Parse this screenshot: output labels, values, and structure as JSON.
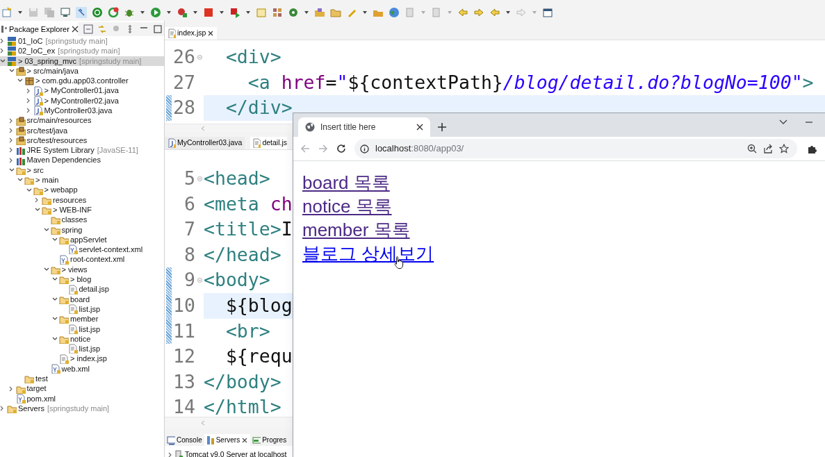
{
  "package_explorer": {
    "title": "Package Explorer",
    "items": [
      {
        "label": "01_IoC",
        "kind": "project",
        "decoration": "[springstudy main]",
        "expanded": false,
        "selected": false
      },
      {
        "label": "02_IoC_ex",
        "kind": "project",
        "decoration": "[springstudy main]",
        "expanded": false,
        "selected": false
      },
      {
        "label": "> 03_spring_mvc",
        "kind": "project",
        "decoration": "[springstudy main]",
        "expanded": true,
        "selected": true,
        "children": [
          {
            "label": "> src/main/java",
            "kind": "source-folder",
            "expanded": true,
            "selected": false,
            "children": [
              {
                "label": "> com.gdu.app03.controller",
                "kind": "package",
                "expanded": true,
                "selected": false,
                "children": [
                  {
                    "label": "> MyController01.java",
                    "kind": "java",
                    "expanded": false,
                    "selected": false
                  },
                  {
                    "label": "> MyController02.java",
                    "kind": "java",
                    "expanded": false,
                    "selected": false
                  },
                  {
                    "label": "MyController03.java",
                    "kind": "java",
                    "expanded": false,
                    "selected": false
                  }
                ]
              }
            ]
          },
          {
            "label": "src/main/resources",
            "kind": "source-folder",
            "expanded": false,
            "selected": false
          },
          {
            "label": "src/test/java",
            "kind": "source-folder",
            "expanded": false,
            "selected": false
          },
          {
            "label": "src/test/resources",
            "kind": "source-folder",
            "expanded": false,
            "selected": false
          },
          {
            "label": "JRE System Library",
            "kind": "library",
            "decoration": "[JavaSE-11]",
            "expanded": false,
            "selected": false
          },
          {
            "label": "Maven Dependencies",
            "kind": "library",
            "expanded": false,
            "selected": false
          },
          {
            "label": "> src",
            "kind": "folder",
            "expanded": true,
            "selected": false,
            "children": [
              {
                "label": "> main",
                "kind": "folder",
                "expanded": true,
                "selected": false,
                "children": [
                  {
                    "label": "> webapp",
                    "kind": "folder",
                    "expanded": true,
                    "selected": false,
                    "children": [
                      {
                        "label": "resources",
                        "kind": "folder",
                        "expanded": false,
                        "selected": false
                      },
                      {
                        "label": "> WEB-INF",
                        "kind": "folder",
                        "expanded": true,
                        "selected": false,
                        "children": [
                          {
                            "label": "classes",
                            "kind": "folder",
                            "selected": false
                          },
                          {
                            "label": "spring",
                            "kind": "folder",
                            "expanded": true,
                            "selected": false,
                            "children": [
                              {
                                "label": "appServlet",
                                "kind": "folder",
                                "expanded": true,
                                "selected": false,
                                "children": [
                                  {
                                    "label": "servlet-context.xml",
                                    "kind": "xml",
                                    "selected": false
                                  }
                                ]
                              },
                              {
                                "label": "root-context.xml",
                                "kind": "xml",
                                "selected": false
                              }
                            ]
                          },
                          {
                            "label": "> views",
                            "kind": "folder",
                            "expanded": true,
                            "selected": false,
                            "children": [
                              {
                                "label": "> blog",
                                "kind": "folder",
                                "expanded": true,
                                "selected": false,
                                "children": [
                                  {
                                    "label": "detail.jsp",
                                    "kind": "jsp",
                                    "selected": false
                                  }
                                ]
                              },
                              {
                                "label": "board",
                                "kind": "folder",
                                "expanded": true,
                                "selected": false,
                                "children": [
                                  {
                                    "label": "list.jsp",
                                    "kind": "jsp",
                                    "selected": false
                                  }
                                ]
                              },
                              {
                                "label": "member",
                                "kind": "folder",
                                "expanded": true,
                                "selected": false,
                                "children": [
                                  {
                                    "label": "list.jsp",
                                    "kind": "jsp",
                                    "selected": false
                                  }
                                ]
                              },
                              {
                                "label": "notice",
                                "kind": "folder",
                                "expanded": true,
                                "selected": false,
                                "children": [
                                  {
                                    "label": "list.jsp",
                                    "kind": "jsp",
                                    "selected": false
                                  }
                                ]
                              },
                              {
                                "label": "> index.jsp",
                                "kind": "jsp",
                                "selected": false
                              }
                            ]
                          },
                          {
                            "label": "web.xml",
                            "kind": "xml",
                            "selected": false
                          }
                        ]
                      }
                    ]
                  }
                ]
              },
              {
                "label": "test",
                "kind": "folder",
                "selected": false
              }
            ]
          },
          {
            "label": "target",
            "kind": "folder",
            "expanded": false,
            "selected": false
          },
          {
            "label": "pom.xml",
            "kind": "xml",
            "selected": false
          }
        ]
      },
      {
        "label": "Servers",
        "kind": "folder",
        "decoration": "[springstudy main]",
        "expanded": false,
        "selected": false
      }
    ]
  },
  "editors": [
    {
      "tabs": [
        {
          "label": "index.jsp",
          "kind": "jsp",
          "selected": true
        }
      ],
      "lines": [
        {
          "number": "26",
          "foldable": true,
          "changed": false,
          "current": false,
          "tokens": [
            {
              "kind": "tag",
              "text": "  <div>"
            }
          ]
        },
        {
          "number": "27",
          "foldable": false,
          "changed": false,
          "current": false,
          "tokens": [
            {
              "kind": "tag",
              "text": "    <a"
            },
            {
              "kind": "attr",
              "text": " href"
            },
            {
              "kind": "plain",
              "text": "="
            },
            {
              "kind": "string",
              "text": "\""
            },
            {
              "kind": "plain",
              "text": "${contextPath}"
            },
            {
              "kind": "string",
              "text": "/blog/detail.do?blogNo=100\""
            },
            {
              "kind": "tag",
              "text": ">"
            }
          ]
        },
        {
          "number": "28",
          "foldable": false,
          "changed": true,
          "current": true,
          "tokens": [
            {
              "kind": "tag",
              "text": "  </div>"
            }
          ]
        }
      ]
    },
    {
      "tabs": [
        {
          "label": "MyController03.java",
          "kind": "java",
          "selected": false
        },
        {
          "label": "detail.js",
          "kind": "jsp",
          "selected": true
        }
      ],
      "lines": [
        {
          "number": "5",
          "foldable": true,
          "changed": false,
          "current": false,
          "tokens": [
            {
              "kind": "tag",
              "text": "<head>"
            }
          ]
        },
        {
          "number": "6",
          "foldable": false,
          "changed": false,
          "current": false,
          "tokens": [
            {
              "kind": "tag",
              "text": "<meta"
            },
            {
              "kind": "attr",
              "text": " ch"
            }
          ]
        },
        {
          "number": "7",
          "foldable": false,
          "changed": false,
          "current": false,
          "tokens": [
            {
              "kind": "tag",
              "text": "<title>"
            },
            {
              "kind": "plain",
              "text": "I"
            }
          ]
        },
        {
          "number": "8",
          "foldable": false,
          "changed": false,
          "current": false,
          "tokens": [
            {
              "kind": "tag",
              "text": "</head>"
            }
          ]
        },
        {
          "number": "9",
          "foldable": true,
          "changed": true,
          "current": false,
          "tokens": [
            {
              "kind": "tag",
              "text": "<body>"
            }
          ]
        },
        {
          "number": "10",
          "foldable": false,
          "changed": true,
          "current": true,
          "tokens": [
            {
              "kind": "plain",
              "text": "  ${blog"
            }
          ]
        },
        {
          "number": "11",
          "foldable": false,
          "changed": true,
          "current": false,
          "tokens": [
            {
              "kind": "tag",
              "text": "  <br>"
            }
          ]
        },
        {
          "number": "12",
          "foldable": false,
          "changed": false,
          "current": false,
          "tokens": [
            {
              "kind": "plain",
              "text": "  ${requ"
            }
          ]
        },
        {
          "number": "13",
          "foldable": false,
          "changed": false,
          "current": false,
          "tokens": [
            {
              "kind": "tag",
              "text": "</body>"
            }
          ]
        },
        {
          "number": "14",
          "foldable": false,
          "changed": false,
          "current": false,
          "tokens": [
            {
              "kind": "tag",
              "text": "</html>"
            }
          ]
        }
      ]
    }
  ],
  "bottom_panel": {
    "tabs": [
      {
        "label": "Console",
        "selected": false
      },
      {
        "label": "Servers",
        "selected": true
      },
      {
        "label": "Progres",
        "selected": false
      }
    ],
    "rows": [
      {
        "label": "Tomcat v9.0 Server at localhost",
        "expanded": false
      }
    ]
  },
  "browser": {
    "tab_title": "Insert title here",
    "url_host": "localhost",
    "url_rest": ":8080/app03/",
    "links": [
      {
        "text": "board 목록",
        "visited": true
      },
      {
        "text": "notice 목록",
        "visited": true
      },
      {
        "text": "member 목록",
        "visited": true
      },
      {
        "text": "블로그 상세보기",
        "visited": false
      }
    ]
  }
}
